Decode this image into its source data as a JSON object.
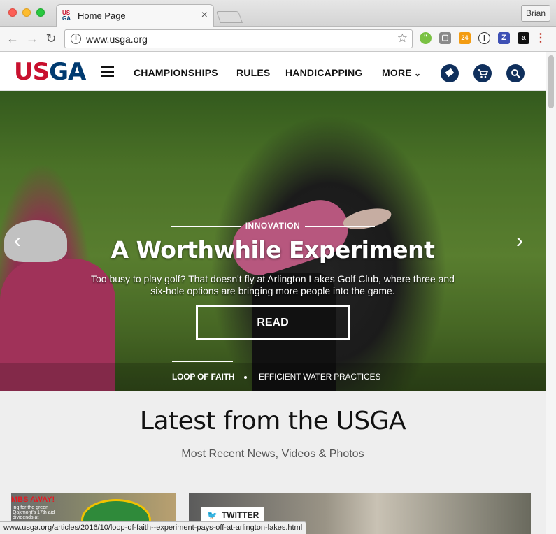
{
  "browser": {
    "tab_title": "Home Page",
    "tab_close": "×",
    "favicon": {
      "line1": "US",
      "line2": "GA"
    },
    "profile_name": "Brian",
    "url": "www.usga.org",
    "status_url": "www.usga.org/articles/2016/10/loop-of-faith--experiment-pays-off-at-arlington-lakes.html",
    "extensions": [
      {
        "name": "evernote-extension-icon",
        "glyph": "\"",
        "color": "#7ac143"
      },
      {
        "name": "grey-extension-icon",
        "glyph": "▢",
        "color": "#8a8a8a"
      },
      {
        "name": "rss-extension-icon",
        "glyph": "24",
        "color": "#f39c12"
      },
      {
        "name": "onepassword-extension-icon",
        "glyph": "①",
        "color": "#ffffff"
      },
      {
        "name": "zotero-extension-icon",
        "glyph": "Z",
        "color": "#3f51b5"
      },
      {
        "name": "amazon-extension-icon",
        "glyph": "a",
        "color": "#111111"
      }
    ]
  },
  "site": {
    "logo_red": "US",
    "logo_blue": "GA",
    "nav": [
      "CHAMPIONSHIPS",
      "RULES",
      "HANDICAPPING",
      "MORE"
    ],
    "icons": [
      "ticket-icon",
      "cart-icon",
      "search-icon"
    ],
    "brand_red": "#c8102e",
    "brand_navy": "#0f2f5c"
  },
  "hero": {
    "kicker": "INNOVATION",
    "title": "A Worthwhile Experiment",
    "description": "Too busy to play golf? That doesn't fly at Arlington Lakes Golf Club, where three and six-hole options are bringing more people into the game.",
    "button": "READ",
    "prev_arrow": "‹",
    "next_arrow": "›",
    "footer_links": [
      "LOOP OF FAITH",
      "EFFICIENT WATER PRACTICES"
    ]
  },
  "latest": {
    "title": "Latest from the USGA",
    "subtitle": "Most Recent News, Videos & Photos",
    "card1_tag": "MBS AWAY!",
    "card1_text": "ing for the green Oakmont's 17th aid dividends at",
    "card2_badge": "TWITTER"
  }
}
